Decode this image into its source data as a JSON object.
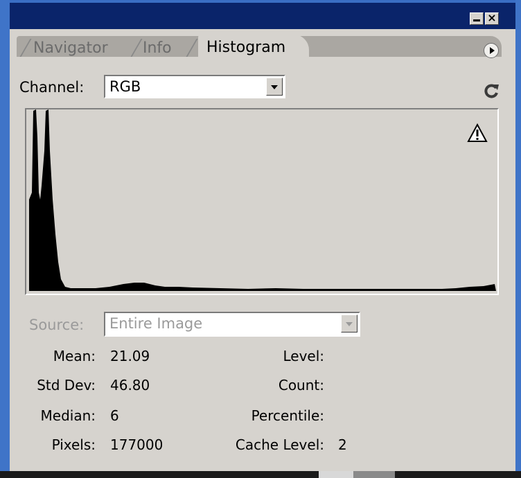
{
  "window": {
    "tabs": [
      {
        "label": "Navigator",
        "active": false
      },
      {
        "label": "Info",
        "active": false
      },
      {
        "label": "Histogram",
        "active": true
      }
    ],
    "minimize_icon": "minimize-icon",
    "close_icon": "close-icon"
  },
  "channel": {
    "label": "Channel:",
    "value": "RGB"
  },
  "histogram": {
    "warning_icon": "warning-icon",
    "refresh_icon": "refresh-icon",
    "fill_color": "#000000"
  },
  "source": {
    "label": "Source:",
    "value": "Entire Image",
    "disabled": true
  },
  "stats": {
    "mean_label": "Mean:",
    "mean": "21.09",
    "std_label": "Std Dev:",
    "std": "46.80",
    "median_label": "Median:",
    "median": "6",
    "pixels_label": "Pixels:",
    "pixels": "177000",
    "level_label": "Level:",
    "count_label": "Count:",
    "percentile_label": "Percentile:",
    "cache_label": "Cache Level:",
    "cache": "2"
  },
  "colors": {
    "titlebar": "#0a246a",
    "panel": "#d6d3ce",
    "desktop": "#3a6ec4"
  }
}
